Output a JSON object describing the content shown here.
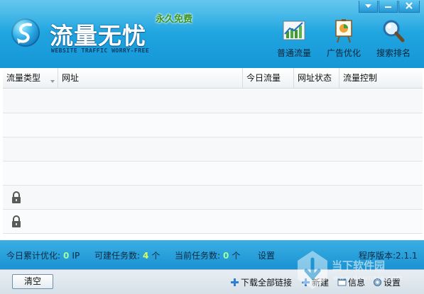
{
  "app": {
    "title": "流量无忧",
    "subtitle": "WEBSITE TRAFFIC WORRY-FREE",
    "badge": "永久免费"
  },
  "window_controls": [
    "minimize-icon",
    "menu-icon",
    "close-icon"
  ],
  "toolbar": [
    {
      "label": "普通流量",
      "icon": "traffic-chart-icon"
    },
    {
      "label": "广告优化",
      "icon": "ad-board-icon"
    },
    {
      "label": "搜索排名",
      "icon": "search-rank-icon"
    }
  ],
  "table": {
    "columns": [
      "流量类型",
      "网址",
      "今日流量",
      "网址状态",
      "流量控制"
    ],
    "rows": [
      {
        "locked": false
      },
      {
        "locked": false
      },
      {
        "locked": false
      },
      {
        "locked": false
      },
      {
        "locked": true
      },
      {
        "locked": true
      }
    ]
  },
  "status": {
    "cumulative_label": "今日累计优化:",
    "cumulative_value": "0",
    "cumulative_unit": "IP",
    "available_label": "可建任务数:",
    "available_value": "4",
    "available_unit": "个",
    "current_label": "当前任务数:",
    "current_value": "0",
    "current_unit": "个",
    "settings_label": "设置",
    "version": "程序版本:2.1.1"
  },
  "bottom": {
    "clear_label": "清空",
    "download_label": "下载全部链接",
    "new_label": "新建",
    "info_label": "信息",
    "settings_label": "设置"
  },
  "watermark": {
    "text": "当下软件园",
    "url": "www.downxia.com"
  },
  "colors": {
    "header_top": "#3fb9ea",
    "header_bottom": "#1596d6",
    "status_number_green": "#9effa0",
    "status_number_yellow": "#d9ff5a",
    "badge_green": "#2a8a10"
  }
}
